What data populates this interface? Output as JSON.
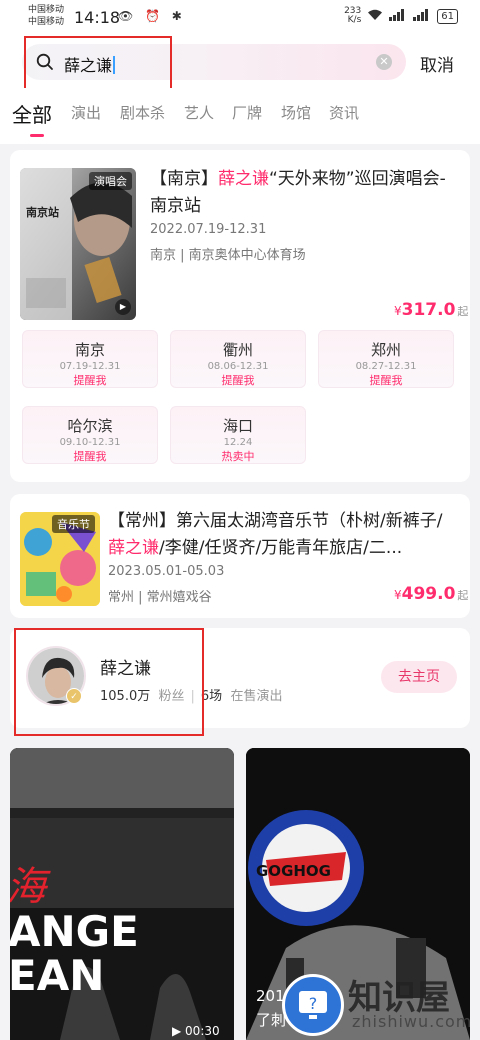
{
  "status_bar": {
    "carrier1": "中国移动",
    "carrier2": "中国移动",
    "time": "14:18",
    "icons": "👁 ⏰ ✱",
    "net_speed": "233\nK/s",
    "signal1": "4G",
    "signal2": "4G",
    "battery": "61"
  },
  "search": {
    "query": "薛之谦",
    "cancel_label": "取消"
  },
  "tabs": [
    "全部",
    "演出",
    "剧本杀",
    "艺人",
    "厂牌",
    "场馆",
    "资讯"
  ],
  "events": [
    {
      "tag": "演唱会",
      "title_pre": "【南京】",
      "title_hl": "薛之谦",
      "title_post": "“天外来物”巡回演唱会-南京站",
      "dates": "2022.07.19-12.31",
      "venue": "南京 | 南京奥体中心体育场",
      "price_symbol": "¥",
      "price": "317.0",
      "price_suffix": "起",
      "poster_text": "南京站",
      "cities": [
        {
          "name": "南京",
          "date": "07.19-12.31",
          "action": "提醒我"
        },
        {
          "name": "衢州",
          "date": "08.06-12.31",
          "action": "提醒我"
        },
        {
          "name": "郑州",
          "date": "08.27-12.31",
          "action": "提醒我"
        },
        {
          "name": "哈尔滨",
          "date": "09.10-12.31",
          "action": "提醒我"
        },
        {
          "name": "海口",
          "date": "12.24",
          "action": "热卖中"
        }
      ]
    },
    {
      "tag": "音乐节",
      "title_pre": "【常州】第六届太湖湾音乐节（朴树/新裤子/",
      "title_hl": "薛之谦",
      "title_post": "/李健/任贤齐/万能青年旅店/二...",
      "dates": "2023.05.01-05.03",
      "venue": "常州 | 常州嬉戏谷",
      "price_symbol": "¥",
      "price": "499.0",
      "price_suffix": "起"
    }
  ],
  "artist": {
    "name": "薛之谦",
    "fans_count": "105.0万",
    "fans_label": "粉丝",
    "shows_count": "6场",
    "shows_label": "在售演出",
    "home_button": "去主页"
  },
  "feed": {
    "left_overlay": "ANGE\nEAN",
    "left_script": "海",
    "duration": "00:30",
    "right_sign": "GOGHOG",
    "right_text_1": "201",
    "right_text_2": "了刺"
  },
  "watermark": {
    "text": "知识屋",
    "url": "zhishiwu.com"
  },
  "colors": {
    "accent": "#ff2c6d",
    "highlight_box": "#e52a2a",
    "home_button_bg": "#fde7ef"
  }
}
